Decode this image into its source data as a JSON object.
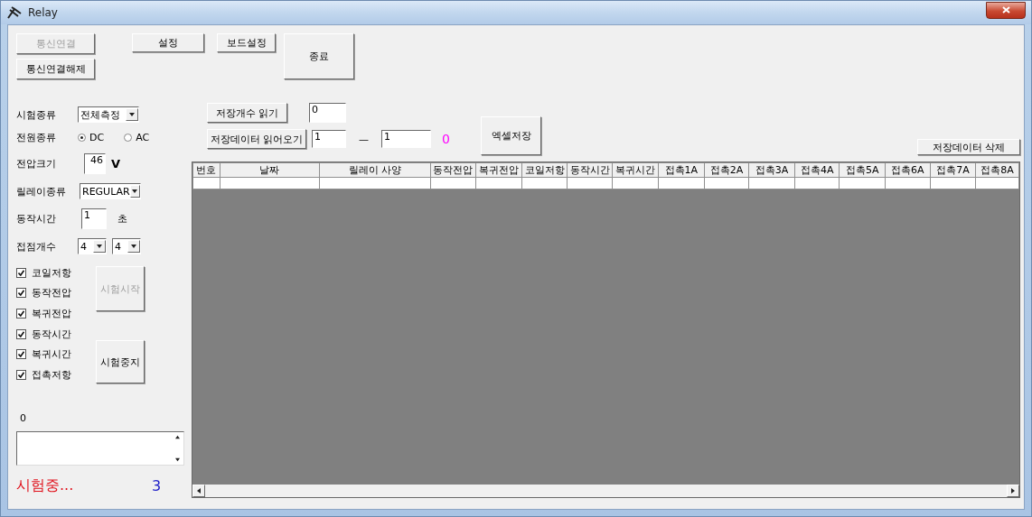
{
  "window": {
    "title": "Relay"
  },
  "top_buttons": [
    {
      "label": "통신연결",
      "disabled": true
    },
    {
      "label": "통신연결해제",
      "disabled": false
    },
    {
      "label": "설정",
      "disabled": false
    },
    {
      "label": "보드설정",
      "disabled": false
    },
    {
      "label": "종료",
      "disabled": false
    }
  ],
  "test_type": {
    "label": "시험종류",
    "value": "전체측정"
  },
  "power_type": {
    "label": "전원종류",
    "options": [
      {
        "label": "DC",
        "selected": true
      },
      {
        "label": "AC",
        "selected": false
      }
    ]
  },
  "voltage": {
    "label": "전압크기",
    "value": "46",
    "unit": "V"
  },
  "relay_type": {
    "label": "릴레이종류",
    "value": "REGULAR"
  },
  "operate_time": {
    "label": "동작시간",
    "value": "1",
    "unit": "초"
  },
  "contact_count": {
    "label": "접점개수",
    "values": [
      "4",
      "4"
    ]
  },
  "checks": [
    {
      "label": "코일저항",
      "checked": true
    },
    {
      "label": "동작전압",
      "checked": true
    },
    {
      "label": "복귀전압",
      "checked": true
    },
    {
      "label": "동작시간",
      "checked": true
    },
    {
      "label": "복귀시간",
      "checked": true
    },
    {
      "label": "접촉저항",
      "checked": true
    }
  ],
  "start_button": {
    "label": "시험시작",
    "disabled": true
  },
  "stop_button": {
    "label": "시험중지",
    "disabled": false
  },
  "counter": "0",
  "status": {
    "text": "시험중...",
    "count": "3"
  },
  "storage": {
    "read_count_button": "저장개수 읽기",
    "count_value": "0",
    "read_data_button": "저장데이터 읽어오기",
    "range_from": "1",
    "range_separator": "—",
    "range_to": "1",
    "loaded": "0",
    "excel_button": "엑셀저장",
    "delete_button": "저장데이터 삭제"
  },
  "table": {
    "columns": [
      "번호",
      "날짜",
      "릴레이 사양",
      "동작전압",
      "복귀전압",
      "코일저항",
      "동작시간",
      "복귀시간",
      "접촉1A",
      "접촉2A",
      "접촉3A",
      "접촉4A",
      "접촉5A",
      "접촉6A",
      "접촉7A",
      "접촉8A"
    ]
  }
}
